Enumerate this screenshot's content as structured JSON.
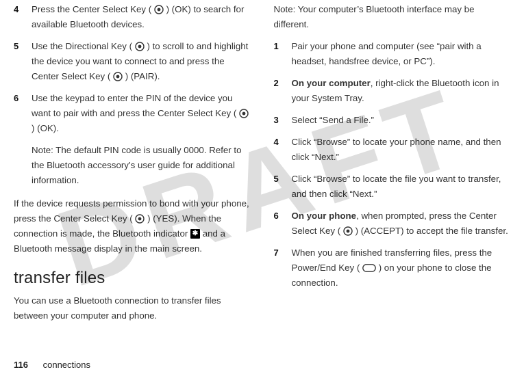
{
  "watermark": "DRAFT",
  "footer": {
    "page": "116",
    "section": "connections"
  },
  "left": {
    "s4": {
      "num": "4",
      "a": "Press the Center Select Key (",
      "b": ") (",
      "ok": "OK",
      "c": ") to search for available Bluetooth devices."
    },
    "s5": {
      "num": "5",
      "a": "Use the Directional Key (",
      "b": ") to scroll to and highlight the device you want to connect to and press the Center Select Key (",
      "c": ") (",
      "pair": "PAIR",
      "d": ")."
    },
    "s6": {
      "num": "6",
      "a": "Use the keypad to enter the PIN of the device you want to pair with and press the Center Select Key (",
      "b": ") (",
      "ok": "OK",
      "c": ")."
    },
    "note": {
      "label": "Note:",
      "text": " The default PIN code is usually 0000. Refer to the Bluetooth accessory’s user guide for additional information."
    },
    "para": {
      "a": "If the device requests permission to bond with your phone, press the Center Select Key (",
      "b": ") (",
      "yes": "YES",
      "c": "). When the connection is made, the Bluetooth indicator ",
      "d": " and a ",
      "bt": "Bluetooth",
      "e": " message display in the main screen."
    },
    "heading": "transfer files",
    "intro": "You can use a Bluetooth connection to transfer files between your computer and phone."
  },
  "right": {
    "topnote": {
      "label": "Note:",
      "text": " Your computer’s Bluetooth interface may be different."
    },
    "s1": {
      "num": "1",
      "text": "Pair your phone and computer (see “pair with a headset, handsfree device, or PC”)."
    },
    "s2": {
      "num": "2",
      "a": "On your computer",
      "b": ", right-click the Bluetooth icon in your System Tray."
    },
    "s3": {
      "num": "3",
      "text": "Select “Send a File.”"
    },
    "s4": {
      "num": "4",
      "text": "Click “Browse” to locate your phone name, and then click “Next.”"
    },
    "s5": {
      "num": "5",
      "text": "Click “Browse” to locate the file you want to transfer, and then click “Next.”"
    },
    "s6": {
      "num": "6",
      "a": "On your phone",
      "b": ", when prompted, press the Center Select Key (",
      "c": ") (",
      "accept": "ACCEPT",
      "d": ") to accept the file transfer."
    },
    "s7": {
      "num": "7",
      "a": "When you are finished transferring files, press the Power/End Key (",
      "b": ") on your phone to close the connection."
    }
  }
}
